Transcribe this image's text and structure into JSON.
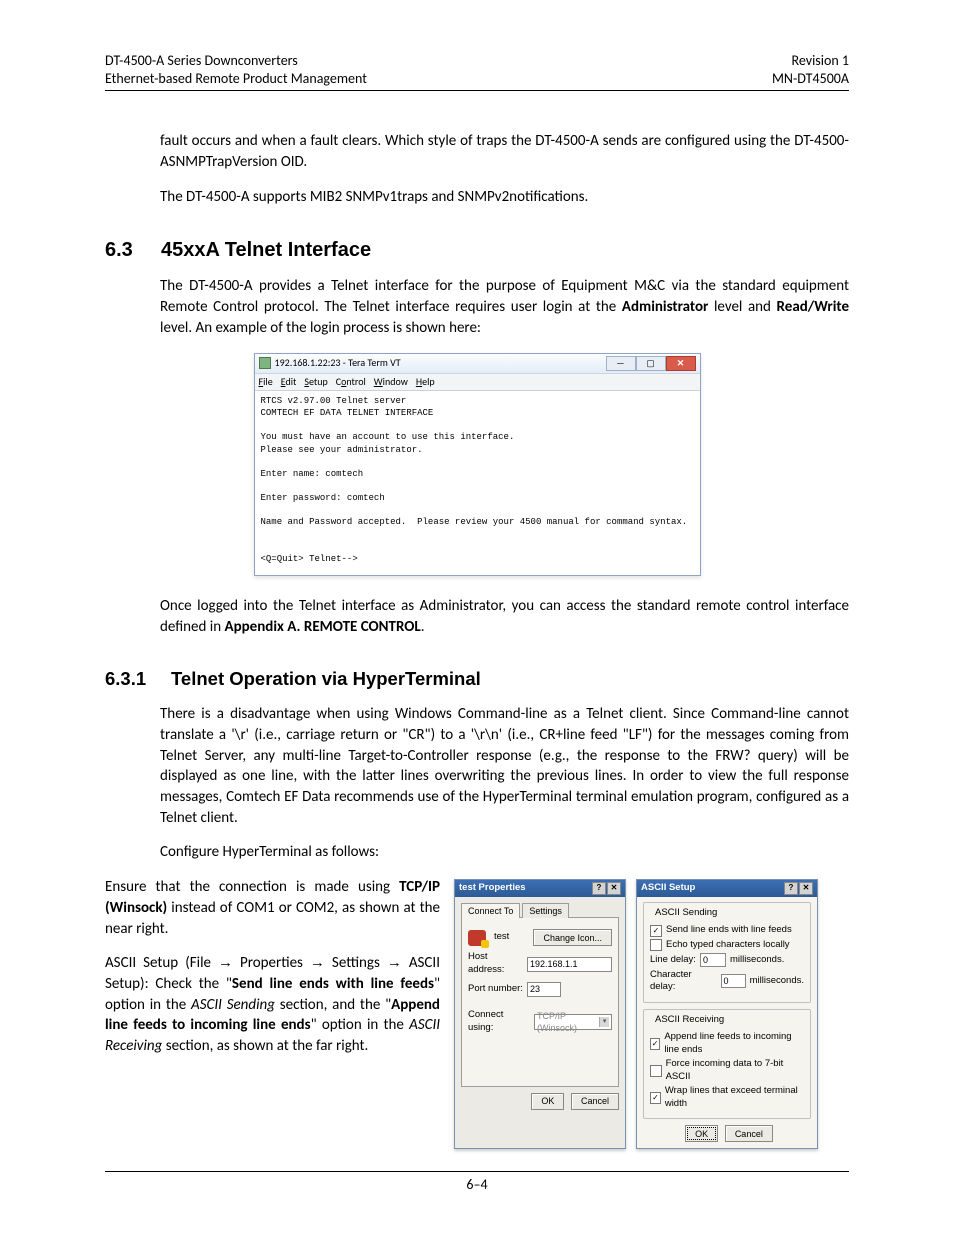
{
  "header": {
    "left": "DT-4500-A Series Downconverters\nEthernet-based Remote Product Management",
    "right": "Revision 1\nMN-DT4500A"
  },
  "para1": "fault occurs and when a fault clears. Which style of traps the DT-4500-A sends are configured using the DT-4500-ASNMPTrapVersion OID.",
  "para2": "The DT-4500-A supports MIB2 SNMPv1traps and SNMPv2notifications.",
  "sec63": {
    "num": "6.3",
    "title": "45xxA Telnet Interface"
  },
  "para3a": "The DT-4500-A provides a Telnet interface for the purpose of Equipment M&C via the standard equipment Remote Control protocol. The Telnet interface requires user login at the ",
  "para3b": "Administrator",
  "para3c": " level and ",
  "para3d": "Read/Write",
  "para3e": " level. An example of the login process is shown here:",
  "tera": {
    "title": "192.168.1.22:23 - Tera Term VT",
    "menu": {
      "file": "File",
      "edit": "Edit",
      "setup": "Setup",
      "control": "Control",
      "window": "Window",
      "help": "Help"
    },
    "text": "RTCS v2.97.00 Telnet server\nCOMTECH EF DATA TELNET INTERFACE\n\nYou must have an account to use this interface.\nPlease see your administrator.\n\nEnter name: comtech\n\nEnter password: comtech\n\nName and Password accepted.  Please review your 4500 manual for command syntax.\n\n\n<Q=Quit> Telnet-->"
  },
  "para4a": "Once logged into the Telnet interface as Administrator, you can access the standard remote control interface defined in ",
  "para4b": "Appendix A. REMOTE CONTROL",
  "para4c": ".",
  "sec631": {
    "num": "6.3.1",
    "title": "Telnet Operation via HyperTerminal"
  },
  "para5": "There is a disadvantage when using Windows Command-line as a Telnet client. Since Command-line cannot translate a '\\r' (i.e., carriage return or \"CR\") to a '\\r\\n' (i.e., CR+line feed \"LF\") for the messages coming from Telnet Server, any multi-line Target-to-Controller response (e.g., the response to the FRW? query) will be displayed as one line, with the latter lines overwriting the previous lines. In order to view the full response messages, Comtech EF Data recommends use of the HyperTerminal terminal emulation program, configured as a Telnet client.",
  "para6": "Configure HyperTerminal as follows:",
  "step1a": "Ensure that the connection is made using ",
  "step1b": "TCP/IP (Winsock)",
  "step1c": " instead of COM1 or COM2, as shown at the near right.",
  "step2a": "ASCII Setup (File ",
  "step2b": " Properties ",
  "step2c": " Settings ",
  "step2d": " ASCII Setup): Check the \"",
  "step2e": "Send line ends with line feeds",
  "step2f": "\" option in the ",
  "step2g": "ASCII Sending",
  "step2h": " section, and the \"",
  "step2i": "Append line feeds to incoming line ends",
  "step2j": "\" option in the ",
  "step2k": "ASCII Receiving",
  "step2l": " section, as shown at the far right.",
  "dlg1": {
    "title": "test Properties",
    "tabs": {
      "connect": "Connect To",
      "settings": "Settings"
    },
    "iconlabel": "test",
    "change": "Change Icon...",
    "host_lbl": "Host address:",
    "host_val": "192.168.1.1",
    "port_lbl": "Port number:",
    "port_val": "23",
    "conn_lbl": "Connect using:",
    "conn_val": "TCP/IP (Winsock)",
    "ok": "OK",
    "cancel": "Cancel"
  },
  "dlg2": {
    "title": "ASCII Setup",
    "grp_send": "ASCII Sending",
    "chk_send1": "Send line ends with line feeds",
    "chk_send2": "Echo typed characters locally",
    "line_delay_lbl": "Line delay:",
    "line_delay_val": "0",
    "line_delay_unit": "milliseconds.",
    "char_delay_lbl": "Character delay:",
    "char_delay_val": "0",
    "char_delay_unit": "milliseconds.",
    "grp_recv": "ASCII Receiving",
    "chk_recv1": "Append line feeds to incoming line ends",
    "chk_recv2": "Force incoming data to 7-bit ASCII",
    "chk_recv3": "Wrap lines that exceed terminal width",
    "ok": "OK",
    "cancel": "Cancel"
  },
  "footer": "6–4"
}
